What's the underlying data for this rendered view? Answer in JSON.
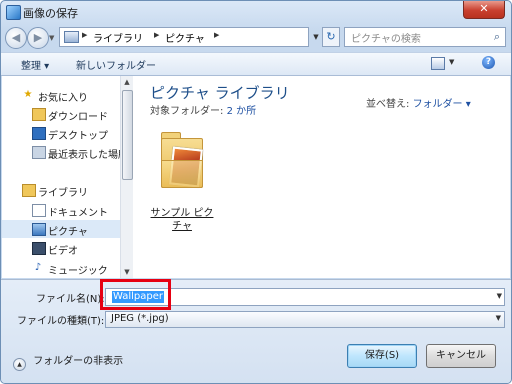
{
  "window": {
    "title": "画像の保存",
    "close_label": "✕"
  },
  "address": {
    "crumbs": [
      "ライブラリ",
      "ピクチャ"
    ],
    "search_placeholder": "ピクチャの検索"
  },
  "toolbar": {
    "organize": "整理 ▾",
    "new_folder": "新しいフォルダー"
  },
  "nav": {
    "items": [
      {
        "label": "お気に入り",
        "icon": "star-icon"
      },
      {
        "label": "ダウンロード",
        "icon": "downloads-folder-icon"
      },
      {
        "label": "デスクトップ",
        "icon": "desktop-icon"
      },
      {
        "label": "最近表示した場所",
        "icon": "recent-places-icon"
      },
      {
        "label": "ライブラリ",
        "icon": "libraries-icon"
      },
      {
        "label": "ドキュメント",
        "icon": "documents-icon"
      },
      {
        "label": "ピクチャ",
        "icon": "pictures-icon",
        "selected": true
      },
      {
        "label": "ビデオ",
        "icon": "videos-icon"
      },
      {
        "label": "ミュージック",
        "icon": "music-icon"
      }
    ]
  },
  "content": {
    "library_title": "ピクチャ ライブラリ",
    "target_label": "対象フォルダー:",
    "target_count": "2 か所",
    "arrange_label": "並べ替え:",
    "arrange_value": "フォルダー ▾",
    "folder_name": "サンプル ピクチャ"
  },
  "form": {
    "filename_label": "ファイル名(N):",
    "filename_value": "Wallpaper",
    "filetype_label": "ファイルの種類(T):",
    "filetype_value": "JPEG (*.jpg)"
  },
  "buttons": {
    "hide_folders": "フォルダーの非表示",
    "save": "保存(S)",
    "cancel": "キャンセル"
  },
  "colors": {
    "highlight": "#e60012",
    "selection": "#3399ff"
  }
}
